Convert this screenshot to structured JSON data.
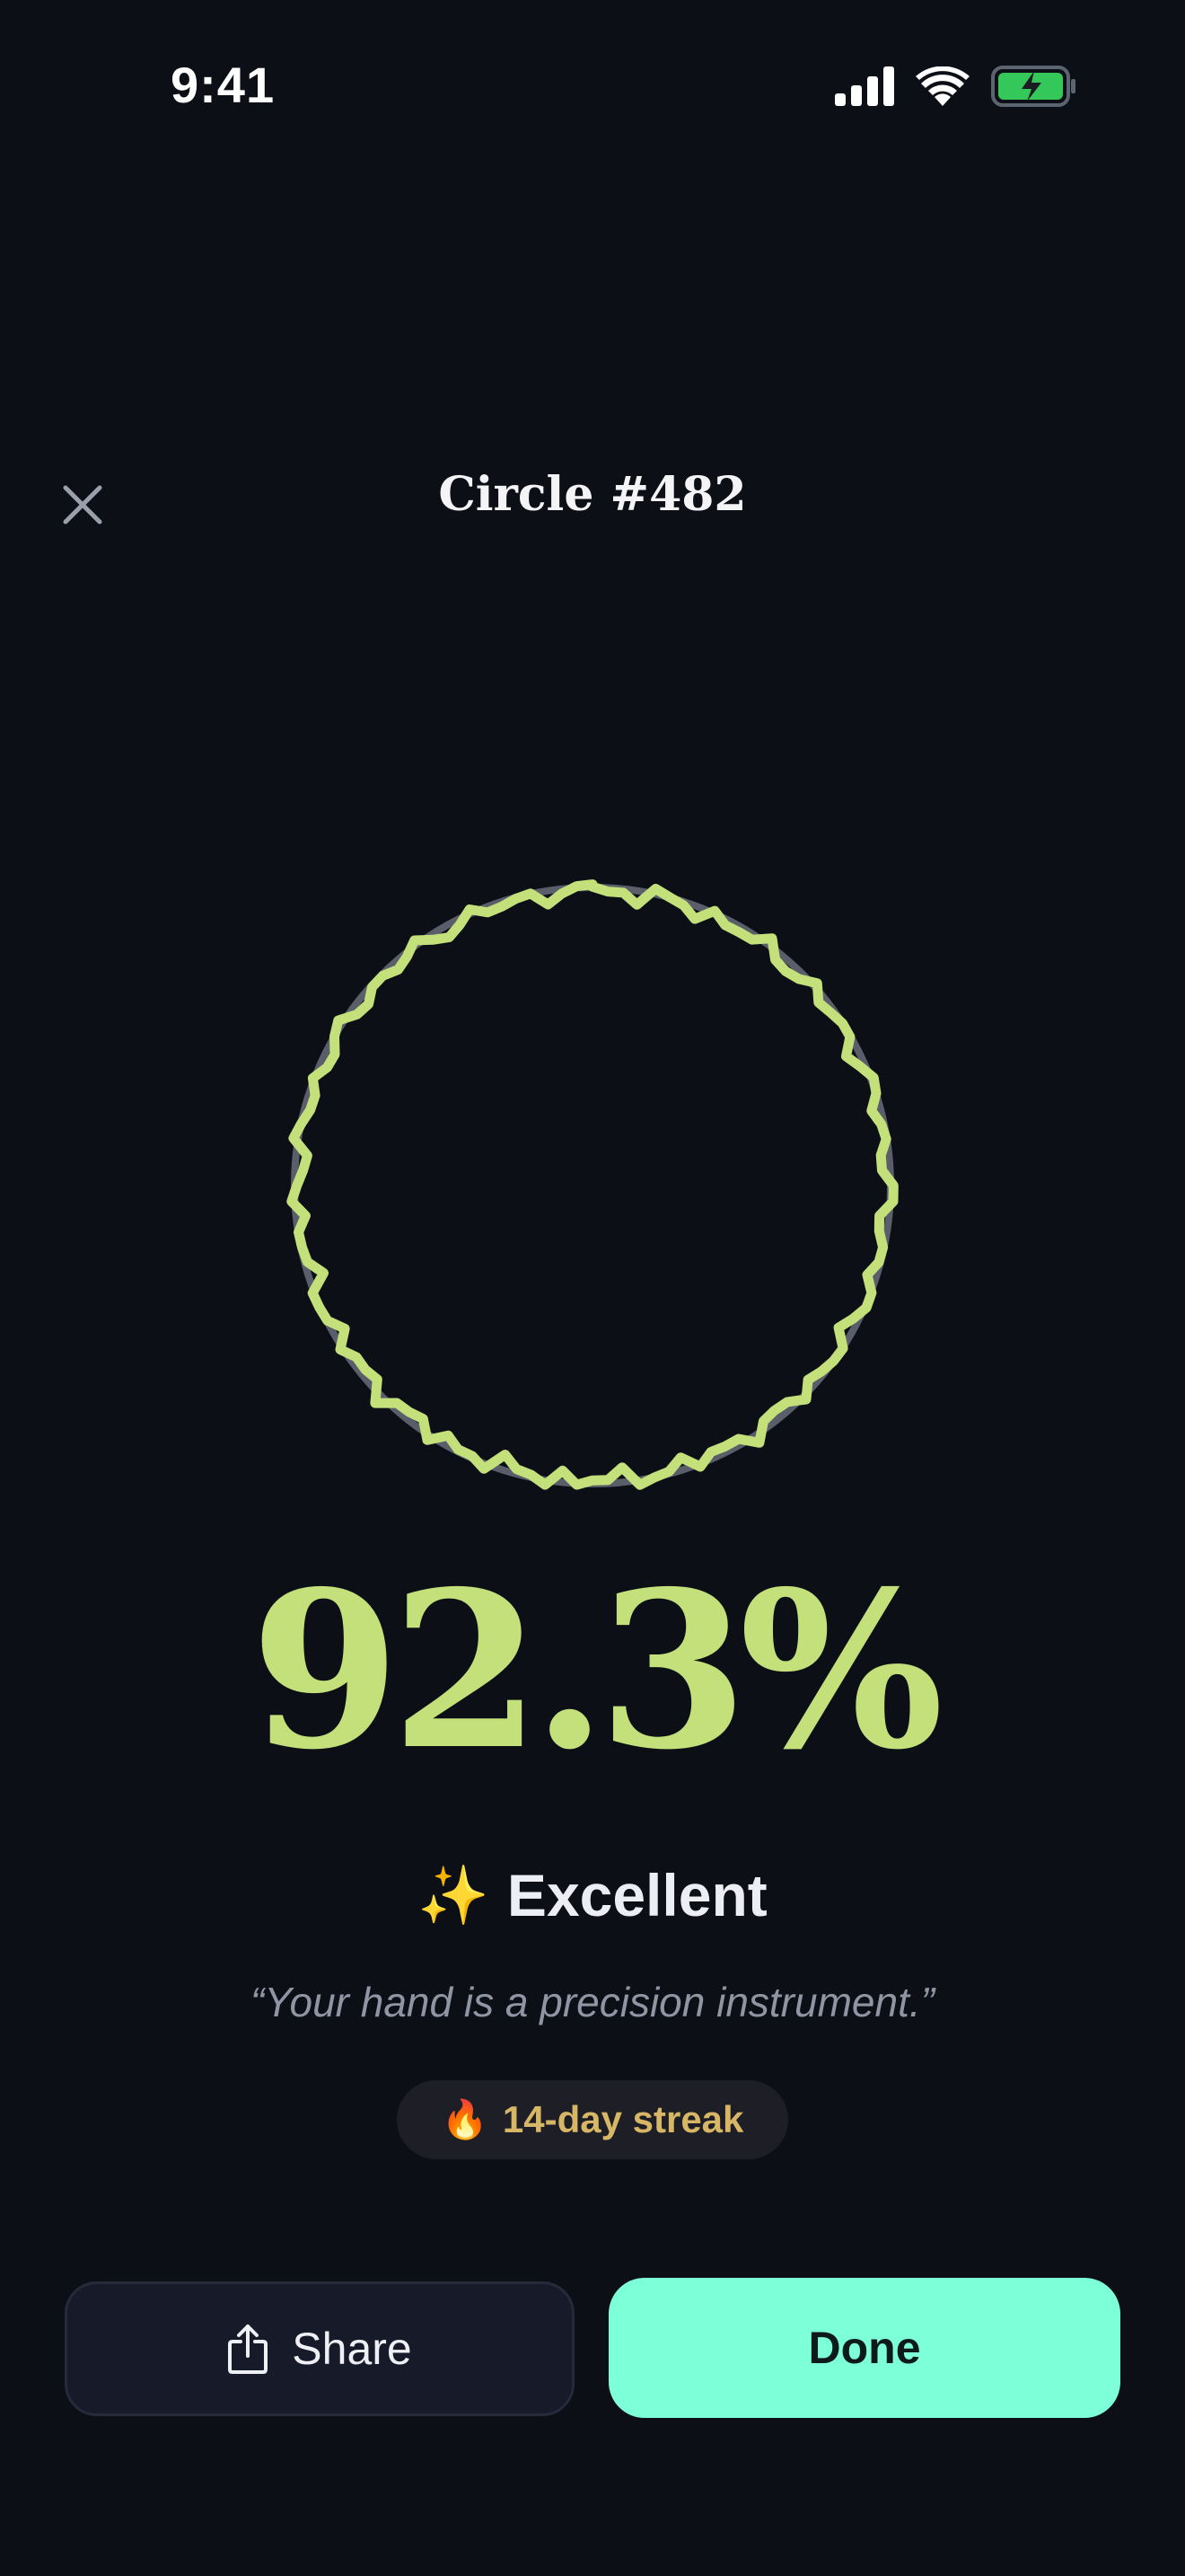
{
  "status_bar": {
    "time": "9:41",
    "icons": [
      "cellular-signal-icon",
      "wifi-icon",
      "battery-charging-icon"
    ],
    "battery_color": "#34c759"
  },
  "header": {
    "title": "Circle #482",
    "close_icon": "close-icon"
  },
  "drawing": {
    "stroke_color": "#c3e07a",
    "reference_circle_color": "#5a5e6a"
  },
  "result": {
    "score": "92.3%",
    "rating_icon": "✨",
    "rating_label": "Excellent",
    "quote": "“Your hand is a precision instrument.”",
    "accent_color": "#c3e07a"
  },
  "streak": {
    "icon": "🔥",
    "label": "14-day streak",
    "color": "#d7b766"
  },
  "actions": {
    "share_label": "Share",
    "share_icon": "share-icon",
    "done_label": "Done",
    "done_color": "#7dffd7"
  }
}
